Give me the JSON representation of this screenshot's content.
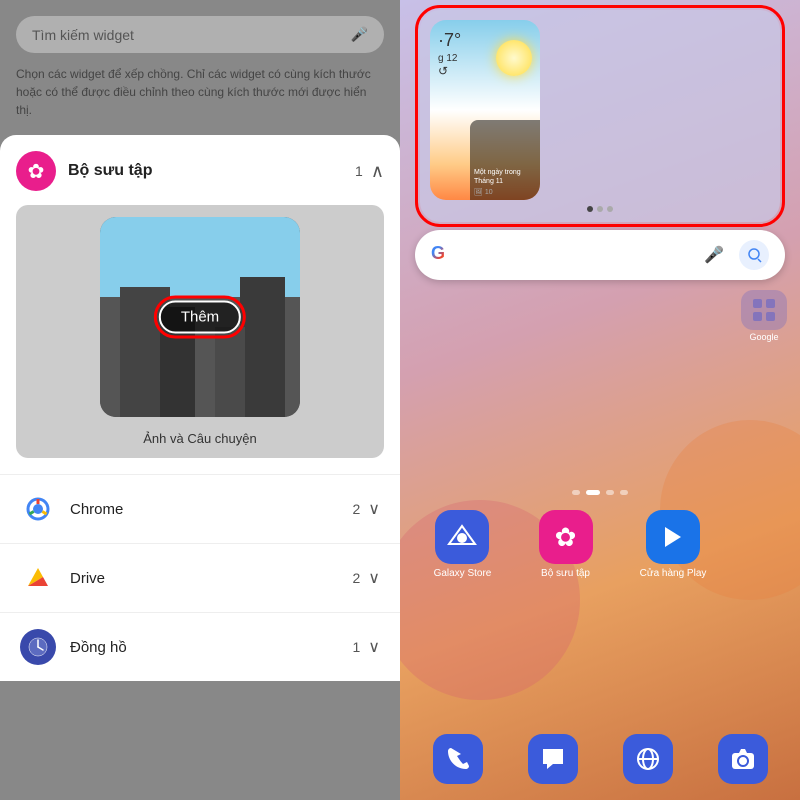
{
  "left": {
    "search_placeholder": "Tìm kiếm widget",
    "description": "Chọn các widget để xếp chồng. Chỉ các widget có cùng kích thước hoặc có thể được điều chỉnh theo cùng kích thước mới được hiển thị.",
    "widget_card": {
      "icon": "✿",
      "title": "Bộ sưu tập",
      "count": "1",
      "them_label": "Thêm",
      "photo_label": "Ảnh và Câu chuyện"
    },
    "apps": [
      {
        "name": "Chrome",
        "count": "2",
        "icon": "chrome"
      },
      {
        "name": "Drive",
        "count": "2",
        "icon": "drive"
      },
      {
        "name": "Đồng hồ",
        "count": "1",
        "icon": "clock"
      }
    ]
  },
  "right": {
    "weather": {
      "temp": "7°",
      "prefix": "·",
      "month_day": "g 12",
      "refresh_icon": "↺"
    },
    "story": {
      "title": "Một ngày trong Tháng 11",
      "count": "🖼 10"
    },
    "search_bar": {
      "placeholder": ""
    },
    "grid_app": {
      "label": "Google",
      "icon": "⊞"
    },
    "center_apps": [
      {
        "label": "Galaxy Store",
        "color": "#3b5bdb"
      },
      {
        "label": "Bộ sưu tập",
        "color": "#e91e8c"
      },
      {
        "label": "Cửa hàng Play",
        "color": "#1a73e8"
      }
    ],
    "dock_apps": [
      "phone",
      "messages",
      "internet",
      "camera"
    ]
  }
}
